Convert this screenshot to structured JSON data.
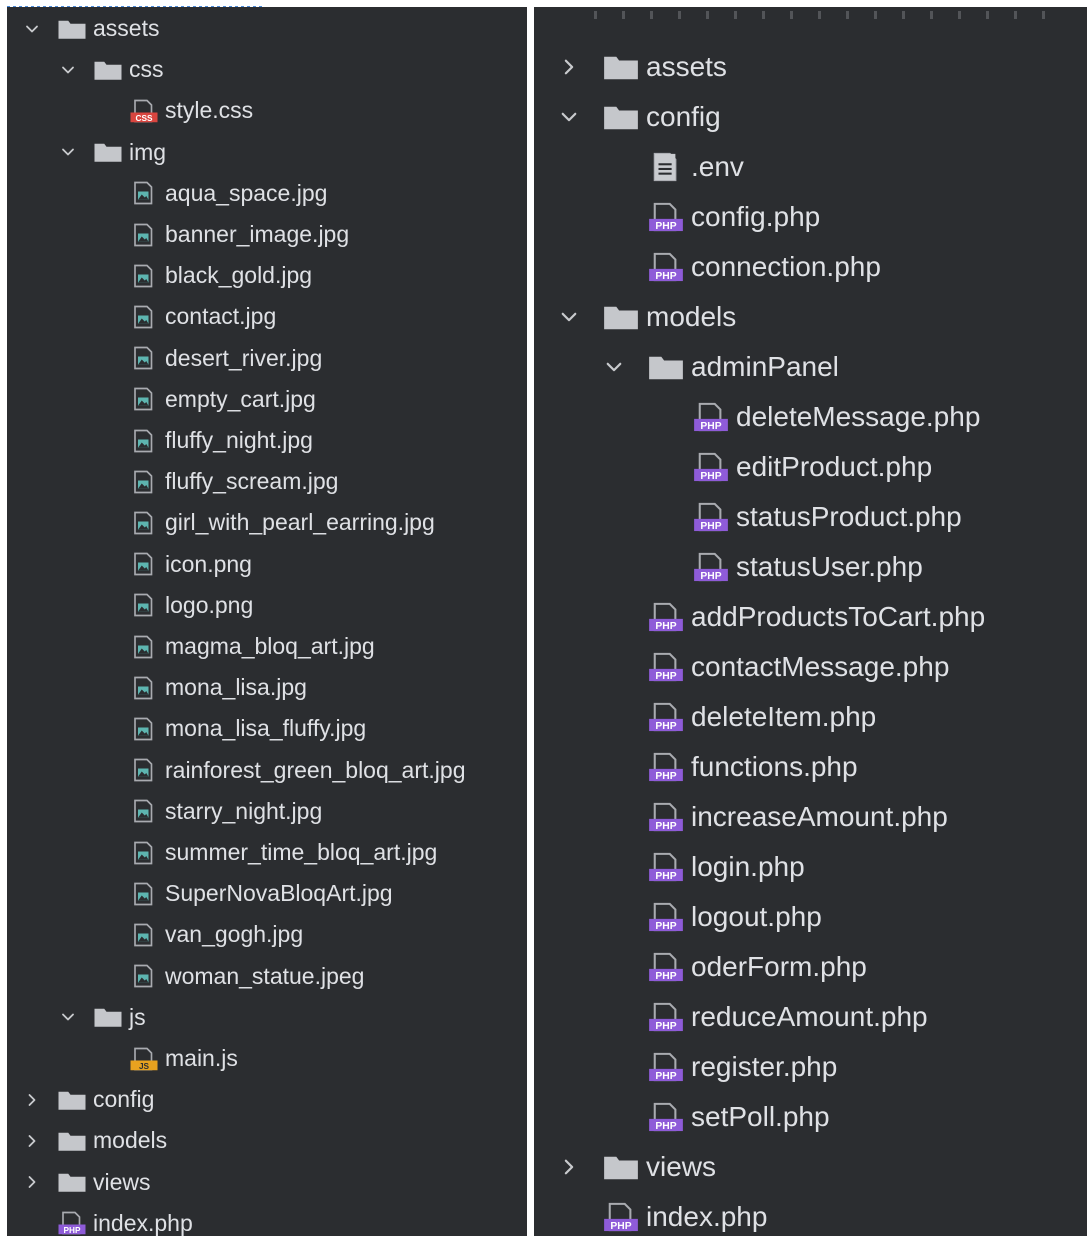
{
  "colors": {
    "panel_bg": "#2b2d30",
    "text": "#dfe1e5",
    "folder": "#c5c7cb",
    "chevron": "#c8cacd",
    "php_badge": "#8e5bd8",
    "css_badge": "#d9453f",
    "js_badge": "#e8a21f",
    "image_icon": "#5db5b0",
    "file_gray": "#a9abb0"
  },
  "left_tree": [
    {
      "depth": 0,
      "chevron": "expanded",
      "icon": "folder-icon",
      "label": "assets"
    },
    {
      "depth": 1,
      "chevron": "expanded",
      "icon": "folder-icon",
      "label": "css"
    },
    {
      "depth": 2,
      "chevron": "none",
      "icon": "css-file-icon",
      "label": "style.css"
    },
    {
      "depth": 1,
      "chevron": "expanded",
      "icon": "folder-icon",
      "label": "img"
    },
    {
      "depth": 2,
      "chevron": "none",
      "icon": "image-file-icon",
      "label": "aqua_space.jpg"
    },
    {
      "depth": 2,
      "chevron": "none",
      "icon": "image-file-icon",
      "label": "banner_image.jpg"
    },
    {
      "depth": 2,
      "chevron": "none",
      "icon": "image-file-icon",
      "label": "black_gold.jpg"
    },
    {
      "depth": 2,
      "chevron": "none",
      "icon": "image-file-icon",
      "label": "contact.jpg"
    },
    {
      "depth": 2,
      "chevron": "none",
      "icon": "image-file-icon",
      "label": "desert_river.jpg"
    },
    {
      "depth": 2,
      "chevron": "none",
      "icon": "image-file-icon",
      "label": "empty_cart.jpg"
    },
    {
      "depth": 2,
      "chevron": "none",
      "icon": "image-file-icon",
      "label": "fluffy_night.jpg"
    },
    {
      "depth": 2,
      "chevron": "none",
      "icon": "image-file-icon",
      "label": "fluffy_scream.jpg"
    },
    {
      "depth": 2,
      "chevron": "none",
      "icon": "image-file-icon",
      "label": "girl_with_pearl_earring.jpg"
    },
    {
      "depth": 2,
      "chevron": "none",
      "icon": "image-file-icon",
      "label": "icon.png"
    },
    {
      "depth": 2,
      "chevron": "none",
      "icon": "image-file-icon",
      "label": "logo.png"
    },
    {
      "depth": 2,
      "chevron": "none",
      "icon": "image-file-icon",
      "label": "magma_bloq_art.jpg"
    },
    {
      "depth": 2,
      "chevron": "none",
      "icon": "image-file-icon",
      "label": "mona_lisa.jpg"
    },
    {
      "depth": 2,
      "chevron": "none",
      "icon": "image-file-icon",
      "label": "mona_lisa_fluffy.jpg"
    },
    {
      "depth": 2,
      "chevron": "none",
      "icon": "image-file-icon",
      "label": "rainforest_green_bloq_art.jpg"
    },
    {
      "depth": 2,
      "chevron": "none",
      "icon": "image-file-icon",
      "label": "starry_night.jpg"
    },
    {
      "depth": 2,
      "chevron": "none",
      "icon": "image-file-icon",
      "label": "summer_time_bloq_art.jpg"
    },
    {
      "depth": 2,
      "chevron": "none",
      "icon": "image-file-icon",
      "label": "SuperNovaBloqArt.jpg"
    },
    {
      "depth": 2,
      "chevron": "none",
      "icon": "image-file-icon",
      "label": "van_gogh.jpg"
    },
    {
      "depth": 2,
      "chevron": "none",
      "icon": "image-file-icon",
      "label": "woman_statue.jpeg"
    },
    {
      "depth": 1,
      "chevron": "expanded",
      "icon": "folder-icon",
      "label": "js"
    },
    {
      "depth": 2,
      "chevron": "none",
      "icon": "js-file-icon",
      "label": "main.js"
    },
    {
      "depth": 0,
      "chevron": "collapsed",
      "icon": "folder-icon",
      "label": "config"
    },
    {
      "depth": 0,
      "chevron": "collapsed",
      "icon": "folder-icon",
      "label": "models"
    },
    {
      "depth": 0,
      "chevron": "collapsed",
      "icon": "folder-icon",
      "label": "views"
    },
    {
      "depth": 0,
      "chevron": "none",
      "icon": "php-file-icon",
      "label": "index.php"
    }
  ],
  "right_tree": [
    {
      "depth": 0,
      "chevron": "collapsed",
      "icon": "folder-icon",
      "label": "assets"
    },
    {
      "depth": 0,
      "chevron": "expanded",
      "icon": "folder-icon",
      "label": "config"
    },
    {
      "depth": 1,
      "chevron": "none",
      "icon": "text-file-icon",
      "label": ".env"
    },
    {
      "depth": 1,
      "chevron": "none",
      "icon": "php-file-icon",
      "label": "config.php"
    },
    {
      "depth": 1,
      "chevron": "none",
      "icon": "php-file-icon",
      "label": "connection.php"
    },
    {
      "depth": 0,
      "chevron": "expanded",
      "icon": "folder-icon",
      "label": "models"
    },
    {
      "depth": 1,
      "chevron": "expanded",
      "icon": "folder-icon",
      "label": "adminPanel"
    },
    {
      "depth": 2,
      "chevron": "none",
      "icon": "php-file-icon",
      "label": "deleteMessage.php"
    },
    {
      "depth": 2,
      "chevron": "none",
      "icon": "php-file-icon",
      "label": "editProduct.php"
    },
    {
      "depth": 2,
      "chevron": "none",
      "icon": "php-file-icon",
      "label": "statusProduct.php"
    },
    {
      "depth": 2,
      "chevron": "none",
      "icon": "php-file-icon",
      "label": "statusUser.php"
    },
    {
      "depth": 1,
      "chevron": "none",
      "icon": "php-file-icon",
      "label": "addProductsToCart.php"
    },
    {
      "depth": 1,
      "chevron": "none",
      "icon": "php-file-icon",
      "label": "contactMessage.php"
    },
    {
      "depth": 1,
      "chevron": "none",
      "icon": "php-file-icon",
      "label": "deleteItem.php"
    },
    {
      "depth": 1,
      "chevron": "none",
      "icon": "php-file-icon",
      "label": "functions.php"
    },
    {
      "depth": 1,
      "chevron": "none",
      "icon": "php-file-icon",
      "label": "increaseAmount.php"
    },
    {
      "depth": 1,
      "chevron": "none",
      "icon": "php-file-icon",
      "label": "login.php"
    },
    {
      "depth": 1,
      "chevron": "none",
      "icon": "php-file-icon",
      "label": "logout.php"
    },
    {
      "depth": 1,
      "chevron": "none",
      "icon": "php-file-icon",
      "label": "oderForm.php"
    },
    {
      "depth": 1,
      "chevron": "none",
      "icon": "php-file-icon",
      "label": "reduceAmount.php"
    },
    {
      "depth": 1,
      "chevron": "none",
      "icon": "php-file-icon",
      "label": "register.php"
    },
    {
      "depth": 1,
      "chevron": "none",
      "icon": "php-file-icon",
      "label": "setPoll.php"
    },
    {
      "depth": 0,
      "chevron": "collapsed",
      "icon": "folder-icon",
      "label": "views"
    },
    {
      "depth": 0,
      "chevron": "none",
      "icon": "php-file-icon",
      "label": "index.php"
    }
  ]
}
